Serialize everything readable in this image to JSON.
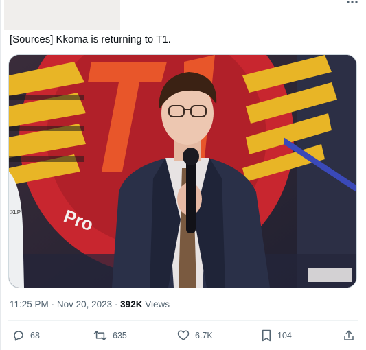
{
  "tweet": {
    "text": "[Sources] Kkoma is returning to T1.",
    "time": "11:25 PM",
    "separator": "·",
    "date": "Nov 20, 2023",
    "views_count": "392K",
    "views_label": "Views"
  },
  "media": {
    "logo_text": "Pro",
    "jacket_text": "XLP"
  },
  "actions": {
    "replies": "68",
    "reposts": "635",
    "likes": "6.7K",
    "bookmarks": "104"
  },
  "icons": [
    "more-icon",
    "reply-icon",
    "repost-icon",
    "like-icon",
    "bookmark-icon",
    "share-icon"
  ],
  "colors": {
    "text": "#0f1419",
    "secondary": "#536471",
    "logo_red": "#c8262f",
    "logo_yellow": "#e8b526"
  }
}
